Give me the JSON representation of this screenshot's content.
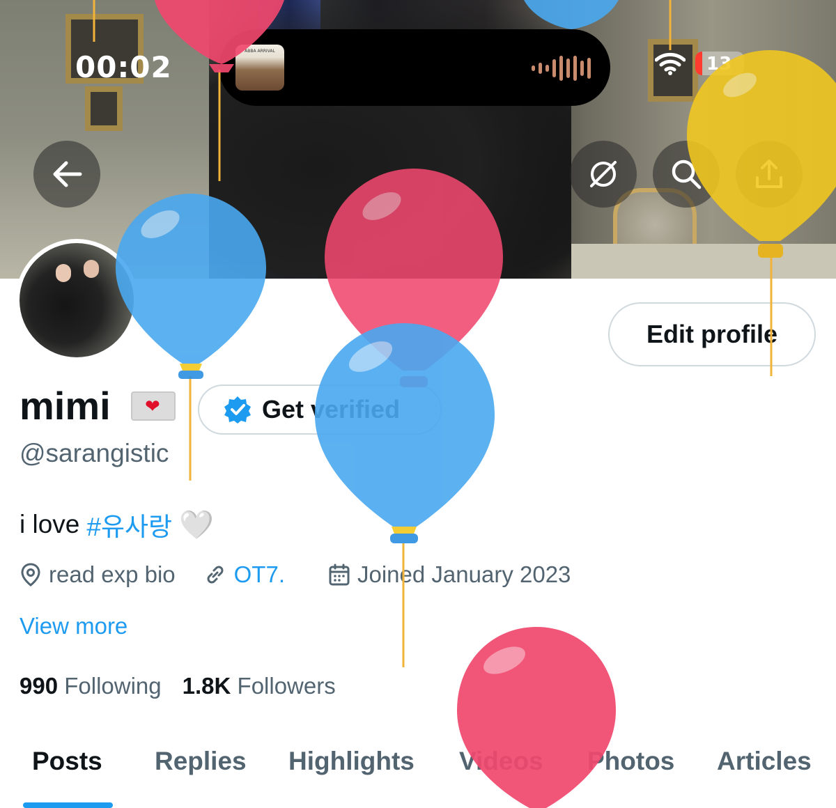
{
  "status_bar": {
    "time": "00:02",
    "battery_level": "13",
    "now_playing_art_label": "ABBA ARRIVAL"
  },
  "header_actions": {
    "back_icon": "arrow-left-icon",
    "grok_icon": "grok-icon",
    "search_icon": "search-icon",
    "share_icon": "share-icon"
  },
  "profile": {
    "display_name": "mimi",
    "emoji": "💌",
    "handle": "@sarangistic",
    "bio_text": "i love",
    "bio_hashtag": "#유사랑",
    "bio_emoji": "🤍",
    "location": "read exp bio",
    "link": "OT7.",
    "joined": "Joined January 2023",
    "view_more": "View more",
    "following_count": "990",
    "following_label": "Following",
    "followers_count": "1.8K",
    "followers_label": "Followers"
  },
  "buttons": {
    "edit_profile": "Edit profile",
    "get_verified": "Get verified"
  },
  "tabs": [
    {
      "label": "Posts",
      "active": true
    },
    {
      "label": "Replies",
      "active": false
    },
    {
      "label": "Highlights",
      "active": false
    },
    {
      "label": "Videos",
      "active": false
    },
    {
      "label": "Photos",
      "active": false
    },
    {
      "label": "Articles",
      "active": false
    }
  ],
  "colors": {
    "accent": "#1d9bf0",
    "balloon_blue": "#4aa8f0",
    "balloon_pink": "#f0486e",
    "balloon_yellow": "#f2c81e"
  }
}
